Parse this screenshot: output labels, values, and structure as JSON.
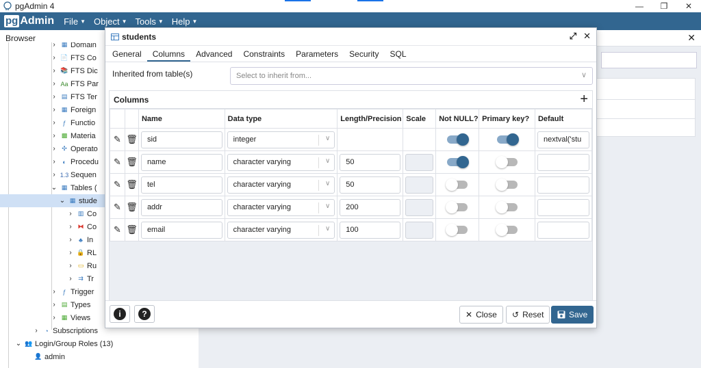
{
  "window": {
    "title": "pgAdmin 4",
    "minimize": "—",
    "restore": "❐",
    "close": "✕"
  },
  "navbar": {
    "logo_pg": "pg",
    "logo_admin": "Admin",
    "menus": [
      "File",
      "Object",
      "Tools",
      "Help"
    ]
  },
  "browser": {
    "title": "Browser",
    "tree": [
      {
        "label": "Domain",
        "icon": "domain-icon"
      },
      {
        "label": "FTS Co",
        "icon": "fts-config-icon"
      },
      {
        "label": "FTS Dic",
        "icon": "fts-dictionary-icon"
      },
      {
        "label": "FTS Par",
        "icon": "fts-parser-icon"
      },
      {
        "label": "FTS Ter",
        "icon": "fts-template-icon"
      },
      {
        "label": "Foreign",
        "icon": "foreign-table-icon"
      },
      {
        "label": "Functio",
        "icon": "function-icon"
      },
      {
        "label": "Materia",
        "icon": "materialized-view-icon"
      },
      {
        "label": "Operato",
        "icon": "operator-icon"
      },
      {
        "label": "Procedu",
        "icon": "procedure-icon"
      },
      {
        "label": "Sequen",
        "icon": "sequence-icon"
      },
      {
        "label": "Tables (",
        "icon": "tables-icon"
      },
      {
        "label": "stude",
        "icon": "table-icon"
      },
      {
        "label": "Co",
        "icon": "columns-icon"
      },
      {
        "label": "Co",
        "icon": "constraints-icon"
      },
      {
        "label": "In",
        "icon": "indexes-icon"
      },
      {
        "label": "RL",
        "icon": "rls-policy-icon"
      },
      {
        "label": "Ru",
        "icon": "rules-icon"
      },
      {
        "label": "Tr",
        "icon": "triggers-icon"
      },
      {
        "label": "Trigger",
        "icon": "trigger-function-icon"
      },
      {
        "label": "Types",
        "icon": "types-icon"
      },
      {
        "label": "Views",
        "icon": "views-icon"
      },
      {
        "label": "Subscriptions",
        "icon": "subscriptions-icon"
      },
      {
        "label": "Login/Group Roles (13)",
        "icon": "roles-icon"
      },
      {
        "label": "admin",
        "icon": "role-user-icon"
      }
    ]
  },
  "dialog": {
    "title": "students",
    "tabs": [
      "General",
      "Columns",
      "Advanced",
      "Constraints",
      "Parameters",
      "Security",
      "SQL"
    ],
    "active_tab": "Columns",
    "inherit_label": "Inherited from table(s)",
    "inherit_placeholder": "Select to inherit from...",
    "columns_label": "Columns",
    "grid_headers": [
      "Name",
      "Data type",
      "Length/Precision",
      "Scale",
      "Not NULL?",
      "Primary key?",
      "Default"
    ],
    "rows": [
      {
        "name": "sid",
        "data_type": "integer",
        "length": "",
        "scale": "",
        "not_null": true,
        "primary_key": true,
        "default": "nextval('stu"
      },
      {
        "name": "name",
        "data_type": "character varying",
        "length": "50",
        "scale": "",
        "not_null": true,
        "primary_key": false,
        "default": ""
      },
      {
        "name": "tel",
        "data_type": "character varying",
        "length": "50",
        "scale": "",
        "not_null": false,
        "primary_key": false,
        "default": ""
      },
      {
        "name": "addr",
        "data_type": "character varying",
        "length": "200",
        "scale": "",
        "not_null": false,
        "primary_key": false,
        "default": ""
      },
      {
        "name": "email",
        "data_type": "character varying",
        "length": "100",
        "scale": "",
        "not_null": false,
        "primary_key": false,
        "default": ""
      }
    ],
    "footer": {
      "info": "i",
      "help": "?",
      "close": "Close",
      "reset": "Reset",
      "save": "Save"
    }
  },
  "colors": {
    "brand": "#326690",
    "toggle_on": "#326690",
    "selected_row": "#cfe0f5"
  }
}
